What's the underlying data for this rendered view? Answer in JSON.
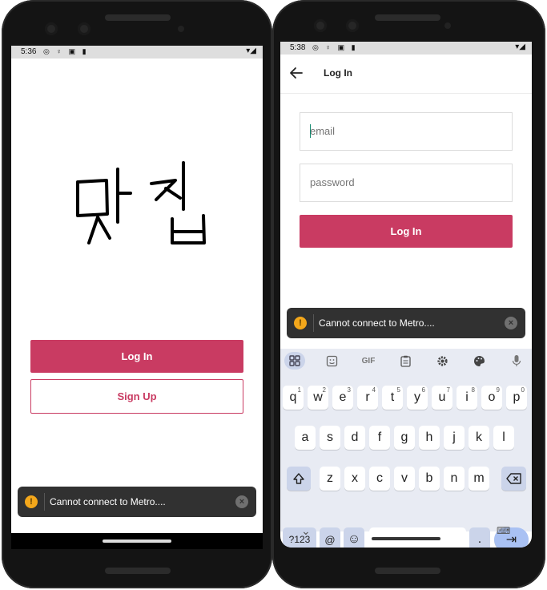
{
  "left_screen": {
    "status": {
      "time": "5:36",
      "icons": "◎ ♀ ▣ ▮",
      "right": "▾◢"
    },
    "logo_text": "맛집",
    "login_button": "Log In",
    "signup_button": "Sign Up",
    "toast": {
      "icon": "!",
      "message": "Cannot connect to Metro....",
      "close": "×"
    }
  },
  "right_screen": {
    "status": {
      "time": "5:38",
      "icons": "◎ ♀ ▣ ▮",
      "right": "▾◢"
    },
    "header": {
      "back": "←",
      "title": "Log In"
    },
    "email_placeholder": "email",
    "password_placeholder": "password",
    "login_button": "Log In",
    "toast": {
      "icon": "!",
      "message": "Cannot connect to Metro....",
      "close": "×"
    },
    "keyboard": {
      "toolbar": [
        "apps-grid-icon",
        "sticker-icon",
        "GIF",
        "clipboard-icon",
        "settings-icon",
        "palette-icon",
        "mic-icon"
      ],
      "gif_label": "GIF",
      "row1": [
        {
          "k": "q",
          "n": "1"
        },
        {
          "k": "w",
          "n": "2"
        },
        {
          "k": "e",
          "n": "3"
        },
        {
          "k": "r",
          "n": "4"
        },
        {
          "k": "t",
          "n": "5"
        },
        {
          "k": "y",
          "n": "6"
        },
        {
          "k": "u",
          "n": "7"
        },
        {
          "k": "i",
          "n": "8"
        },
        {
          "k": "o",
          "n": "9"
        },
        {
          "k": "p",
          "n": "0"
        }
      ],
      "row2": [
        "a",
        "s",
        "d",
        "f",
        "g",
        "h",
        "j",
        "k",
        "l"
      ],
      "row3": [
        "z",
        "x",
        "c",
        "v",
        "b",
        "n",
        "m"
      ],
      "row4": {
        "symbols": "?123",
        "at": "@",
        "emoji": "☺",
        "space": "",
        "period": ".",
        "enter": "⇥"
      },
      "hide_icon": "⌄",
      "switch_icon": "⌨"
    }
  }
}
